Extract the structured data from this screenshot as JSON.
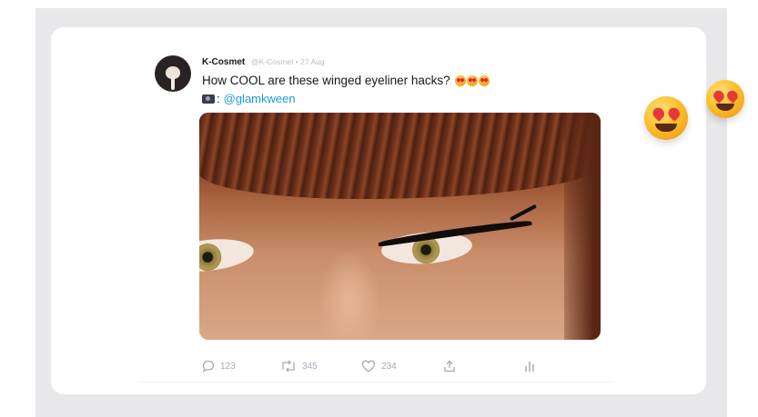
{
  "tweet": {
    "author": "K-Cosmet",
    "meta": "@K-Cosmet • 27 Aug",
    "text": "How COOL are these winged eyeliner hacks?",
    "credit_separator": ":",
    "credit_handle": "@glamkween"
  },
  "actions": {
    "reply_count": "123",
    "retweet_count": "345",
    "like_count": "234"
  },
  "icons": [
    "reply-icon",
    "retweet-icon",
    "heart-icon",
    "share-icon",
    "analytics-icon",
    "camera-icon",
    "heart-eyes-emoji"
  ],
  "colors": {
    "link": "#1d9bd8",
    "action_grey": "#a3acb6",
    "frame_bg": "#e8e8ea"
  }
}
